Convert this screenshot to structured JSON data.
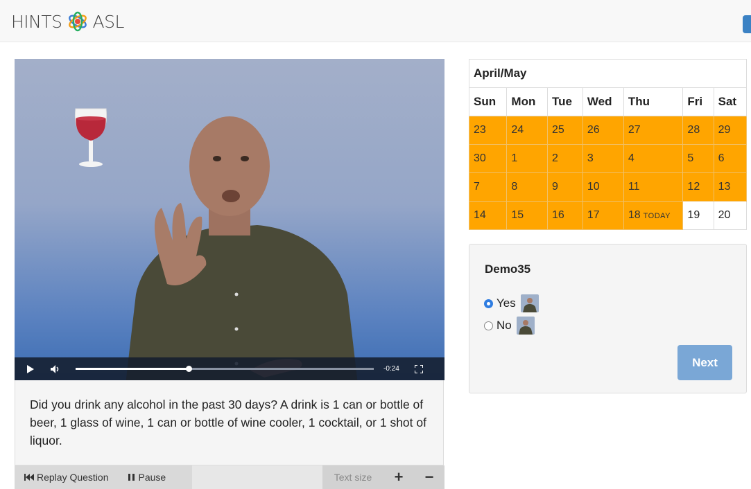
{
  "header": {
    "brand_left": "HINTS",
    "brand_right": "ASL"
  },
  "video": {
    "time_remaining": "-0:24",
    "progress_fraction": 0.38
  },
  "question": {
    "text": "Did you drink any alcohol in the past 30 days? A drink is 1 can or bottle of beer, 1 glass of wine, 1 can or bottle of wine cooler, 1 cocktail, or 1 shot of liquor."
  },
  "bottom_bar": {
    "replay_label": "Replay Question",
    "pause_label": "Pause",
    "text_size_label": "Text size",
    "increase_label": "+",
    "decrease_label": "−"
  },
  "calendar": {
    "title": "April/May",
    "days": [
      "Sun",
      "Mon",
      "Tue",
      "Wed",
      "Thu",
      "Fri",
      "Sat"
    ],
    "weeks": [
      [
        "23",
        "24",
        "25",
        "26",
        "27",
        "28",
        "29"
      ],
      [
        "30",
        "1",
        "2",
        "3",
        "4",
        "5",
        "6"
      ],
      [
        "7",
        "8",
        "9",
        "10",
        "11",
        "12",
        "13"
      ],
      [
        "14",
        "15",
        "16",
        "17",
        "18",
        "19",
        "20"
      ]
    ],
    "today_label": "TODAY",
    "highlight_color": "#ffa500"
  },
  "form": {
    "title": "Demo35",
    "options": [
      {
        "label": "Yes",
        "selected": true
      },
      {
        "label": "No",
        "selected": false
      }
    ],
    "next_label": "Next",
    "accent": "#2f7de1"
  }
}
